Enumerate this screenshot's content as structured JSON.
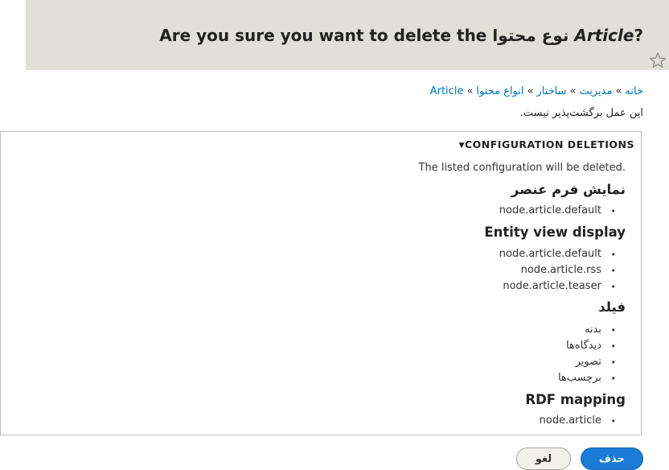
{
  "header": {
    "title_prefix": "Are you sure you want to delete the ",
    "title_type": "نوع محتوا",
    "title_name": "Article",
    "title_suffix": "?"
  },
  "breadcrumb": [
    "خانه",
    "مدیریت",
    "ساختار",
    "انواع محتوا",
    "Article"
  ],
  "warning": "این عمل برگشت‌پذیر نیست.",
  "config": {
    "summary": "CONFIGURATION DELETIONS",
    "intro": "The listed configuration will be deleted.",
    "groups": [
      {
        "title": "نمایش فرم عنصر",
        "items": [
          "node.article.default"
        ]
      },
      {
        "title": "Entity view display",
        "items": [
          "node.article.default",
          "node.article.rss",
          "node.article.teaser"
        ]
      },
      {
        "title": "فیلد",
        "items": [
          "بدنه",
          "دیدگاه‌ها",
          "تصویر",
          "برچسب‌ها"
        ]
      },
      {
        "title": "RDF mapping",
        "items": [
          "node.article"
        ]
      }
    ]
  },
  "actions": {
    "delete": "حذف",
    "cancel": "لغو"
  }
}
